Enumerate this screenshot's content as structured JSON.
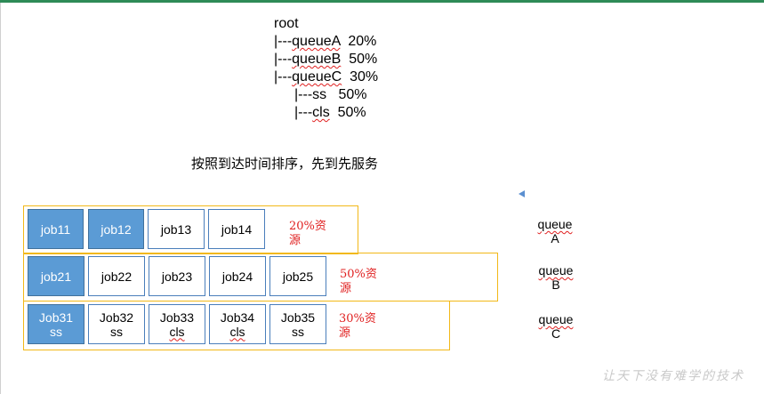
{
  "tree": {
    "root": "root",
    "queue_a": {
      "prefix": "|---",
      "name": "queueA",
      "share": "  20%"
    },
    "queue_b": {
      "prefix": "|---",
      "name": "queueB",
      "share": "  50%"
    },
    "queue_c": {
      "prefix": "|---",
      "name": "queueC",
      "share": "  30%"
    },
    "child_ss": {
      "prefix": "|---ss",
      "share": "   50%"
    },
    "child_cls": {
      "prefix": "|---",
      "name": "cls",
      "share": "  50%"
    }
  },
  "heading": "按照到达时间排序，先到先服务",
  "rows": {
    "a": {
      "jobs": [
        {
          "line1": "job11",
          "line2": ""
        },
        {
          "line1": "job12",
          "line2": ""
        },
        {
          "line1": "job13",
          "line2": ""
        },
        {
          "line1": "job14",
          "line2": ""
        }
      ],
      "pct_line1": "20%资",
      "pct_line2": "源",
      "queue_line1": "queue",
      "queue_line2": "A"
    },
    "b": {
      "jobs": [
        {
          "line1": "job21",
          "line2": ""
        },
        {
          "line1": "job22",
          "line2": ""
        },
        {
          "line1": "job23",
          "line2": ""
        },
        {
          "line1": "job24",
          "line2": ""
        },
        {
          "line1": "job25",
          "line2": ""
        }
      ],
      "pct_line1": "50%资",
      "pct_line2": "源",
      "queue_line1": "queue",
      "queue_line2": "B"
    },
    "c": {
      "jobs": [
        {
          "line1": "Job31",
          "line2": "ss"
        },
        {
          "line1": "Job32",
          "line2": "ss"
        },
        {
          "line1": "Job33",
          "line2": "cls"
        },
        {
          "line1": "Job34",
          "line2": "cls"
        },
        {
          "line1": "Job35",
          "line2": "ss"
        }
      ],
      "pct_line1": "30%资",
      "pct_line2": "源",
      "queue_line1": "queue",
      "queue_line2": "C"
    }
  },
  "watermark": "让天下没有难学的技术",
  "colors": {
    "active_job": "#5b9bd5",
    "job_border": "#4a7ebb",
    "frame": "#f2b818",
    "percent_text": "#e02020",
    "top_bar": "#2e8b57"
  }
}
